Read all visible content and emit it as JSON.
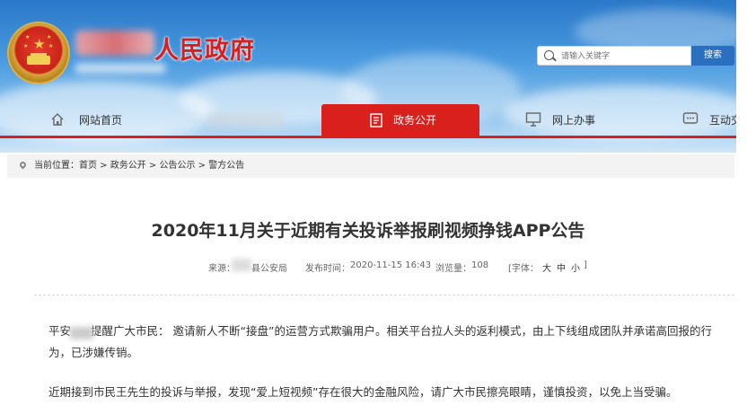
{
  "header": {
    "site_title": "人民政府",
    "search_placeholder": "请输入关键字",
    "search_button": "搜索"
  },
  "nav": {
    "items": [
      {
        "label": "网站首页",
        "icon": "home-icon"
      },
      {
        "label": "政务公开",
        "icon": "document-icon",
        "active": true
      },
      {
        "label": "网上办事",
        "icon": "monitor-icon"
      },
      {
        "label": "互动交",
        "icon": "chat-icon"
      }
    ]
  },
  "breadcrumb": {
    "prefix": "当前位置：",
    "items": [
      "首页",
      "政务公开",
      "公告公示",
      "警方公告"
    ],
    "separator": " > "
  },
  "article": {
    "title": "2020年11月关于近期有关投诉举报刷视频挣钱APP公告",
    "source_label": "来源：",
    "source_value": "县公安局",
    "publish_label": "发布时间：",
    "publish_value": "2020-11-15 16:43",
    "views_label": "浏览量：",
    "views_value": "108",
    "font_label": "[字体：",
    "font_large": "大",
    "font_medium": "中",
    "font_small": "小",
    "font_close": "]",
    "para1_a": "平安",
    "para1_b": "提醒广大市民：  邀请新人不断“接盘”的运营方式欺骗用户。相关平台拉人头的返利模式，由上下线组成团队并承诺高回报的行",
    "para1_c": "为，已涉嫌传销。",
    "para2": "近期接到市民王先生的投诉与举报，发现“爱上短视频”存在很大的金融风险，请广大市民擦亮眼睛，谨慎投资，以免上当受骗。"
  },
  "colors": {
    "accent_red": "#d9201d",
    "sky_blue": "#4a9be0",
    "search_blue": "#2b6fc0"
  }
}
